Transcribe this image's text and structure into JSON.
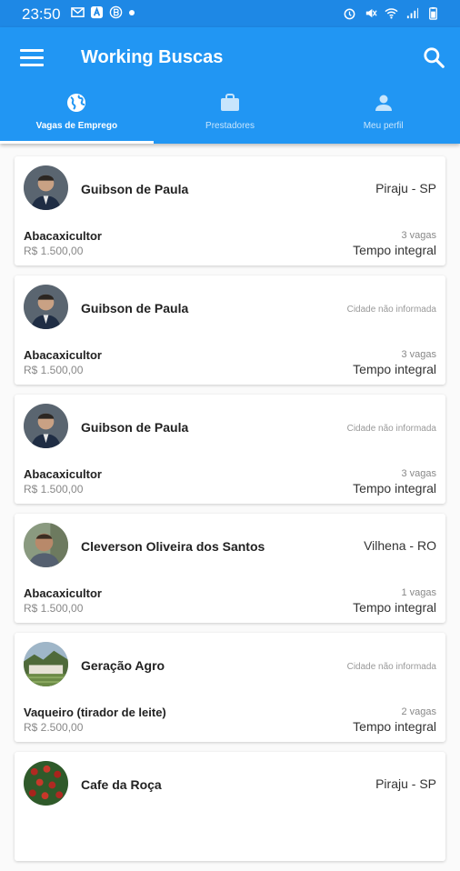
{
  "status_bar": {
    "time": "23:50",
    "left_icons": [
      "gmail-icon",
      "a-app-icon",
      "b-app-icon",
      "dot-icon"
    ],
    "right_icons": [
      "alarm-icon",
      "mute-icon",
      "wifi-icon",
      "signal-icon",
      "battery-icon"
    ]
  },
  "app_bar": {
    "title": "Working Buscas",
    "menu_icon": "menu-icon",
    "search_icon": "search-icon",
    "color": "#2196f3"
  },
  "tabs": [
    {
      "label": "Vagas de Emprego",
      "icon": "globe-icon",
      "active": true
    },
    {
      "label": "Prestadores",
      "icon": "briefcase-icon",
      "active": false
    },
    {
      "label": "Meu perfil",
      "icon": "person-icon",
      "active": false
    }
  ],
  "jobs": [
    {
      "name": "Guibson de Paula",
      "city": "Piraju - SP",
      "city_na": false,
      "title": "Abacaxicultor",
      "salary": "R$ 1.500,00",
      "vagas": "3 vagas",
      "period": "Tempo integral",
      "avatar": "person-photo"
    },
    {
      "name": "Guibson de Paula",
      "city": "Cidade não informada",
      "city_na": true,
      "title": "Abacaxicultor",
      "salary": "R$ 1.500,00",
      "vagas": "3 vagas",
      "period": "Tempo integral",
      "avatar": "person-photo"
    },
    {
      "name": "Guibson de Paula",
      "city": "Cidade não informada",
      "city_na": true,
      "title": "Abacaxicultor",
      "salary": "R$ 1.500,00",
      "vagas": "3 vagas",
      "period": "Tempo integral",
      "avatar": "person-photo"
    },
    {
      "name": "Cleverson Oliveira dos Santos",
      "city": "Vilhena - RO",
      "city_na": false,
      "title": "Abacaxicultor",
      "salary": "R$ 1.500,00",
      "vagas": "1 vagas",
      "period": "Tempo integral",
      "avatar": "outdoor-photo"
    },
    {
      "name": "Geração Agro",
      "city": "Cidade não informada",
      "city_na": true,
      "title": "Vaqueiro (tirador de leite)",
      "salary": "R$ 2.500,00",
      "vagas": "2 vagas",
      "period": "Tempo integral",
      "avatar": "farm-photo"
    },
    {
      "name": "Cafe da Roça",
      "city": "Piraju - SP",
      "city_na": false,
      "title": "",
      "salary": "",
      "vagas": "",
      "period": "",
      "avatar": "coffee-photo"
    }
  ]
}
